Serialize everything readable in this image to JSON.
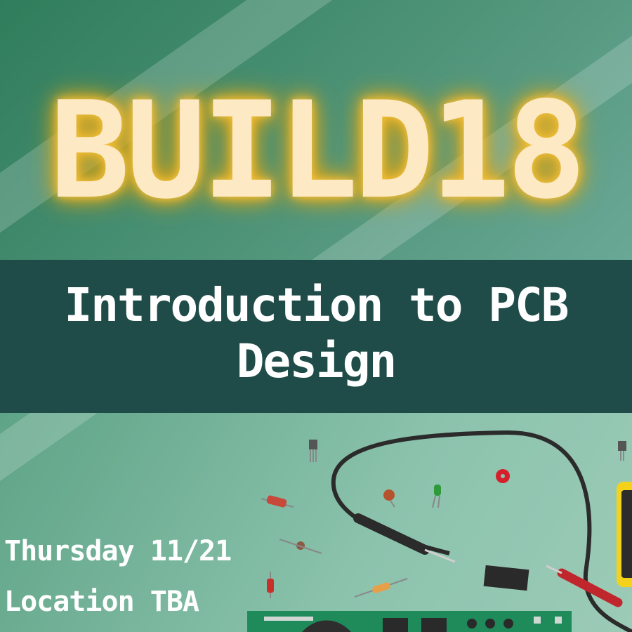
{
  "poster": {
    "title": "BUILD18",
    "subtitle_line1": "Introduction to PCB",
    "subtitle_line2": "Design",
    "date": "Thursday 11/21",
    "location": "Location TBA"
  },
  "colors": {
    "top_background": "#2f7d5c",
    "band": "#1f4c48",
    "title_text": "#fde9c4",
    "title_glow": "#f5c542",
    "bottom_background": "#8cc3ad"
  },
  "illustration": {
    "icons": [
      "multimeter-icon",
      "probe-cable-icon",
      "transistor-icon",
      "resistor-icon",
      "capacitor-icon",
      "led-icon",
      "ic-chip-icon",
      "circuit-board-icon",
      "washer-icon"
    ]
  }
}
